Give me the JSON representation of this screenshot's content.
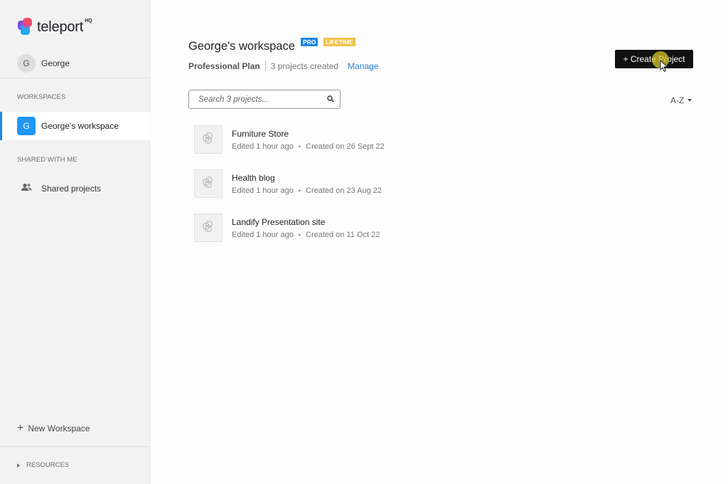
{
  "brand": {
    "name": "teleport",
    "suffix": "HQ"
  },
  "user": {
    "initial": "G",
    "name": "George"
  },
  "sidebar": {
    "workspaces_label": "WORKSPACES",
    "workspace": {
      "initial": "G",
      "label": "George's workspace"
    },
    "shared_label": "SHARED WITH ME",
    "shared_projects": "Shared projects",
    "new_workspace": "New Workspace",
    "resources": "RESOURCES"
  },
  "header": {
    "title": "George's workspace",
    "badge_pro": "PRO",
    "badge_lifetime": "LIFETIME",
    "plan": "Professional Plan",
    "projects_count": "3 projects created",
    "manage": "Manage",
    "create_button": "+ Create Project"
  },
  "search": {
    "placeholder": "Search 3 projects..."
  },
  "sort": {
    "label": "A-Z"
  },
  "projects": [
    {
      "name": "Furniture Store",
      "edited": "Edited 1 hour ago",
      "created": "Created on 26 Sept 22"
    },
    {
      "name": "Health blog",
      "edited": "Edited 1 hour ago",
      "created": "Created on 23 Aug 22"
    },
    {
      "name": "Landify Presentation site",
      "edited": "Edited 1 hour ago",
      "created": "Created on 11 Oct 22"
    }
  ],
  "colors": {
    "accent": "#1e88e5",
    "lifetime": "#f0c14b",
    "button": "#111111"
  }
}
